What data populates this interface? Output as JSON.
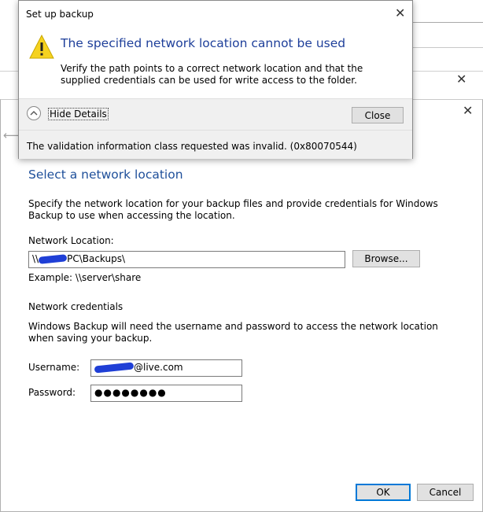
{
  "dialog": {
    "title": "Set up backup",
    "heading": "The specified network location cannot be used",
    "body": "Verify the path points to a correct network location and that the supplied credentials can be used for write access to the folder.",
    "hide_details": "Hide Details",
    "close_button": "Close",
    "error_text": "The validation information class requested was invalid. (0x80070544)"
  },
  "wizard": {
    "section_title": "Select a network location",
    "description": "Specify the network location for your backup files and provide credentials for Windows Backup to use when accessing the location.",
    "network_location_label": "Network Location:",
    "network_location_prefix": "\\\\",
    "network_location_suffix": "PC\\Backups\\",
    "browse_button": "Browse...",
    "example": "Example: \\\\server\\share",
    "credentials_heading": "Network credentials",
    "credentials_description": "Windows Backup will need the username and password to access the network location when saving your backup.",
    "username_label": "Username:",
    "username_suffix": "@live.com",
    "password_label": "Password:",
    "password_value": "●●●●●●●●",
    "ok_button": "OK",
    "cancel_button": "Cancel"
  },
  "icons": {
    "warning": "warning-icon",
    "close": "close-icon",
    "back": "back-arrow-icon",
    "chevron": "chevron-up-icon"
  },
  "colors": {
    "heading_blue": "#1e4f9a",
    "warning_yellow": "#f5d21f",
    "redaction_blue": "#1f3fd6",
    "focus_blue": "#0078d7"
  }
}
